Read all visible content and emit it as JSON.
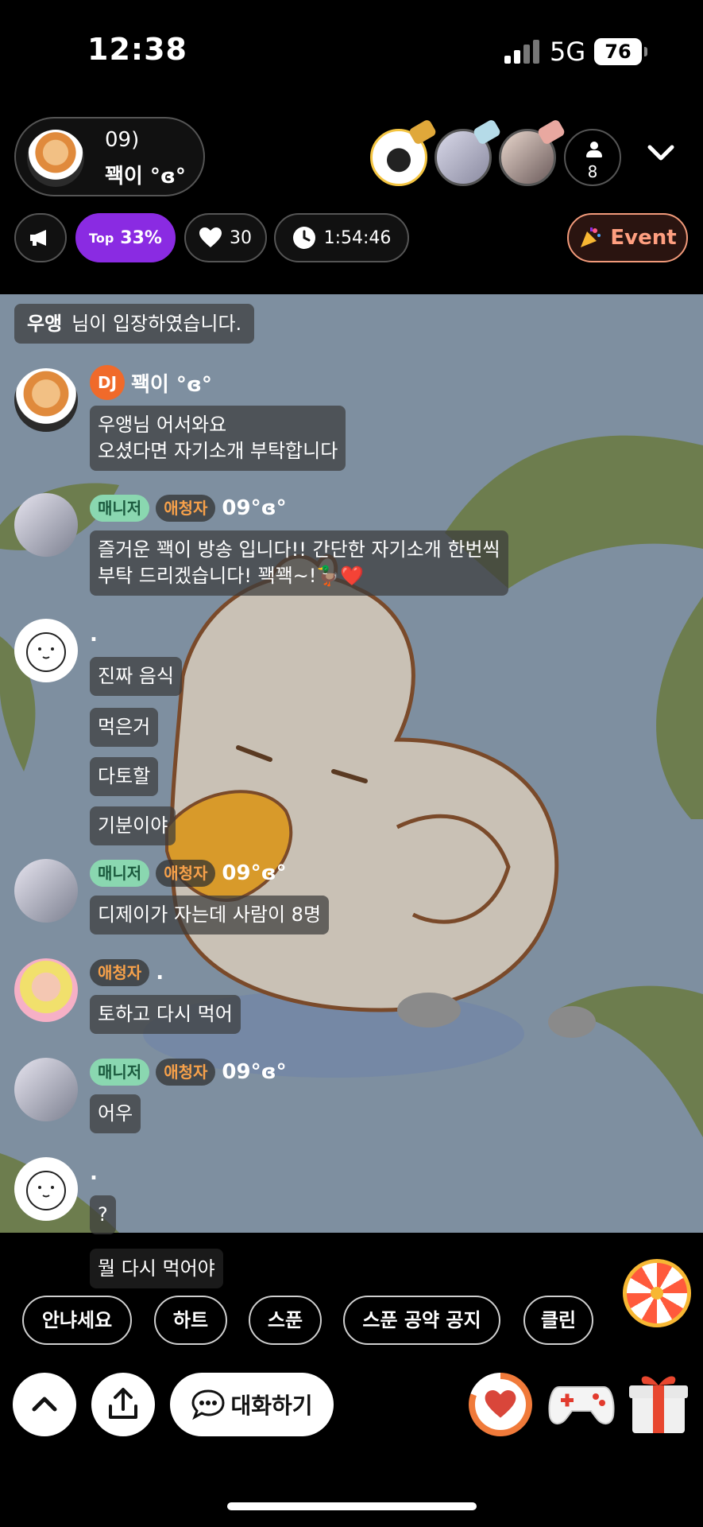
{
  "status_bar": {
    "time": "12:38",
    "network": "5G",
    "battery": "76"
  },
  "host": {
    "line1": "09)",
    "name": "꽥이 °ɞ°"
  },
  "viewers": {
    "count": "8"
  },
  "stats": {
    "top_label": "Top",
    "top_value": "33%",
    "likes": "30",
    "elapsed": "1:54:46",
    "event_label": "Event"
  },
  "colors": {
    "top_pill": "#8a2be2",
    "dj_badge": "#f06a2a",
    "manager_badge": "#8ad7b0",
    "fan_text": "#f7a14a",
    "event_border": "#f19a7a"
  },
  "system_message": {
    "user": "우앵",
    "text": "님이 입장하였습니다."
  },
  "chat": {
    "m1": {
      "badge": "DJ",
      "user": "꽥이 °ɞ°",
      "text": "우앵님 어서와요\n오셨다면 자기소개 부탁합니다"
    },
    "m2": {
      "badge1": "매니저",
      "badge2": "애청자",
      "user": "09°ɞ°",
      "text": "즐거운 꽥이 방송 입니다!! 간단한 자기소개 한번씩\n부탁 드리겠습니다! 꽥꽥~!🦆❤️"
    },
    "m3": {
      "user": ".",
      "texts": [
        "진짜 음식",
        "먹은거",
        "다토할",
        "기분이야"
      ]
    },
    "m4": {
      "badge1": "매니저",
      "badge2": "애청자",
      "user": "09°ɞ°",
      "text": "디제이가 자는데 사람이 8명"
    },
    "m5": {
      "badge1": "애청자",
      "user": ".",
      "text": "토하고 다시 먹어"
    },
    "m6": {
      "badge1": "매니저",
      "badge2": "애청자",
      "user": "09°ɞ°",
      "text": "어우"
    },
    "m7": {
      "user": ".",
      "text": "?"
    }
  },
  "last_message": "뭘 다시 먹어야",
  "quick_replies": [
    "안냐세요",
    "하트",
    "스푼",
    "스푼 공약 공지",
    "클린"
  ],
  "bottom_bar": {
    "chat_label": "대화하기"
  }
}
